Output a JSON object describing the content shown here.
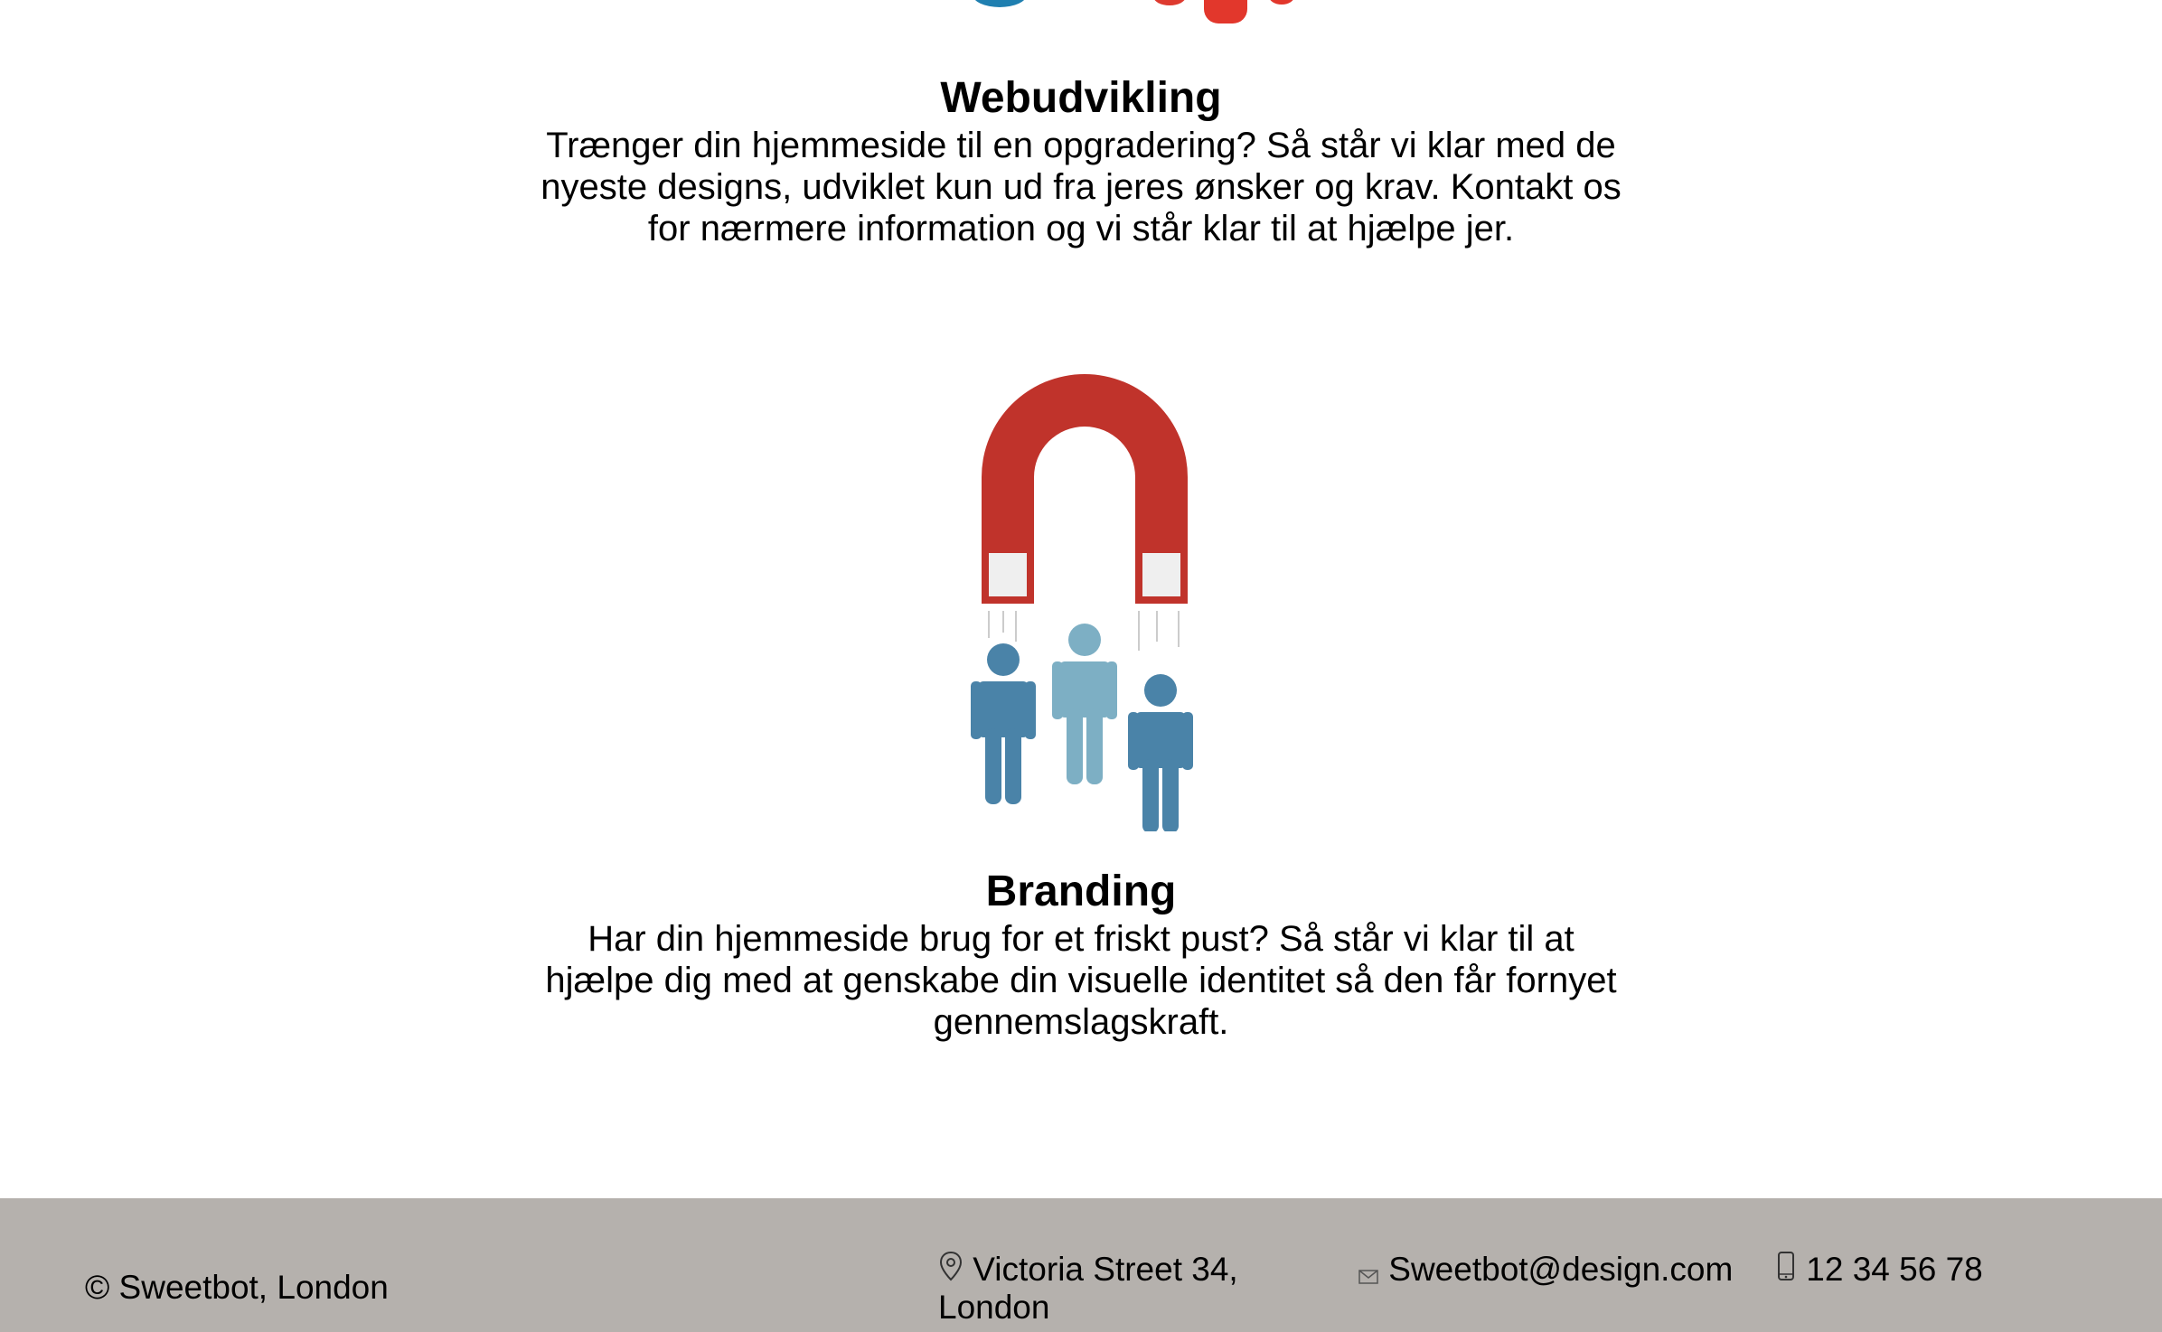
{
  "colors": {
    "accent_red": "#c0332b",
    "accent_blue": "#4a83a8",
    "accent_light_blue": "#7dafc4",
    "footer_bg": "#b5b1ad"
  },
  "services": [
    {
      "title": "Webudvikling",
      "text": "Trænger din hjemmeside til en opgradering? Så står vi klar med de nyeste designs, udviklet kun ud fra jeres ønsker og krav. Kontakt os for nærmere information og vi står klar til at hjælpe jer.",
      "icon": "web-illustration-icon"
    },
    {
      "title": "Branding",
      "text": "Har din hjemmeside brug for et friskt pust? Så står vi klar til at hjælpe dig med at genskabe din visuelle identitet så den får fornyet gennemslagskraft.",
      "icon": "magnet-people-icon"
    }
  ],
  "footer": {
    "copyright": "© Sweetbot, London",
    "address": "Victoria Street 34, London",
    "email": "Sweetbot@design.com",
    "phone": "12 34 56 78",
    "address_icon": "location-pin-icon",
    "email_icon": "envelope-icon",
    "phone_icon": "mobile-phone-icon"
  }
}
